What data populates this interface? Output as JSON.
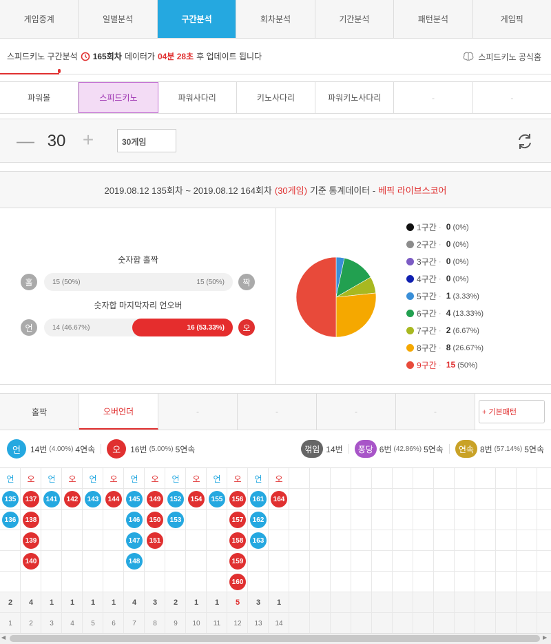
{
  "nav": {
    "tabs": [
      "게임중계",
      "일별분석",
      "구간분석",
      "회차분석",
      "기간분석",
      "패턴분석",
      "게임픽"
    ],
    "active": 2
  },
  "info": {
    "prefix": "스피드키노 구간분석",
    "round": "165회차",
    "middle": "데이터가",
    "time": "04분 28초",
    "suffix": "후 업데이트 됩니다",
    "official": "스피드키노 공식홈"
  },
  "games": {
    "tabs": [
      "파워볼",
      "스피드키노",
      "파워사다리",
      "키노사다리",
      "파워키노사다리",
      "-",
      "-"
    ],
    "active": 1
  },
  "counter": {
    "minus": "—",
    "value": "30",
    "plus": "+",
    "select": "30게임"
  },
  "stats": {
    "range": "2019.08.12 135회차 ~ 2019.08.12 164회차",
    "games": "(30게임)",
    "basis": "기준 통계데이터 -",
    "source": "베픽 라이브스코어"
  },
  "oddeven": {
    "title": "숫자합 홀짝",
    "left_icon": "홀",
    "right_icon": "짝",
    "left_text": "15 (50%)",
    "right_text": "15 (50%)",
    "left_value": 15,
    "right_value": 15
  },
  "overunder": {
    "title": "숫자합 마지막자리 언오버",
    "left_icon": "언",
    "right_icon": "오",
    "left_text": "14 (46.67%)",
    "right_text": "16 (53.33%)",
    "left_value": 14,
    "right_value": 16
  },
  "chart_data": {
    "type": "pie",
    "labels": [
      "1구간",
      "2구간",
      "3구간",
      "4구간",
      "5구간",
      "6구간",
      "7구간",
      "8구간",
      "9구간"
    ],
    "values": [
      0,
      0,
      0,
      0,
      1,
      4,
      2,
      8,
      15
    ],
    "pct": [
      "(0%)",
      "(0%)",
      "(0%)",
      "(0%)",
      "(3.33%)",
      "(13.33%)",
      "(6.67%)",
      "(26.67%)",
      "(50%)"
    ],
    "colors": [
      "#111111",
      "#8c8c8c",
      "#7c5cc4",
      "#1020b0",
      "#3a8fd8",
      "#22a050",
      "#a8b820",
      "#f5a800",
      "#e84a3a"
    ]
  },
  "pattern": {
    "tabs": [
      "홀짝",
      "오버언더",
      "-",
      "-",
      "-",
      "-"
    ],
    "active": 1,
    "basic_button": "+ 기본패턴"
  },
  "summary": {
    "under_icon": "언",
    "under_count": "14번",
    "under_pct": "(4.00%)",
    "under_streak": "4연속",
    "over_icon": "오",
    "over_count": "16번",
    "over_pct": "(5.00%)",
    "over_streak": "5연속",
    "break_label": "꺾임",
    "break_count": "14번",
    "pong_label": "퐁당",
    "pong_count": "6번",
    "pong_pct": "(42.86%)",
    "pong_streak": "5연속",
    "streak_label": "연속",
    "streak_count": "8번",
    "streak_pct": "(57.14%)",
    "streak_streak": "5연속"
  },
  "grid": {
    "columns": [
      {
        "head": "언",
        "type": "u",
        "balls": [
          "135",
          "136"
        ],
        "count": "2",
        "index": "1"
      },
      {
        "head": "오",
        "type": "o",
        "balls": [
          "137",
          "138",
          "139",
          "140"
        ],
        "count": "4",
        "index": "2"
      },
      {
        "head": "언",
        "type": "u",
        "balls": [
          "141"
        ],
        "count": "1",
        "index": "3"
      },
      {
        "head": "오",
        "type": "o",
        "balls": [
          "142"
        ],
        "count": "1",
        "index": "4"
      },
      {
        "head": "언",
        "type": "u",
        "balls": [
          "143"
        ],
        "count": "1",
        "index": "5"
      },
      {
        "head": "오",
        "type": "o",
        "balls": [
          "144"
        ],
        "count": "1",
        "index": "6"
      },
      {
        "head": "언",
        "type": "u",
        "balls": [
          "145",
          "146",
          "147",
          "148"
        ],
        "count": "4",
        "index": "7"
      },
      {
        "head": "오",
        "type": "o",
        "balls": [
          "149",
          "150",
          "151"
        ],
        "count": "3",
        "index": "8"
      },
      {
        "head": "언",
        "type": "u",
        "balls": [
          "152",
          "153"
        ],
        "count": "2",
        "index": "9"
      },
      {
        "head": "오",
        "type": "o",
        "balls": [
          "154"
        ],
        "count": "1",
        "index": "10"
      },
      {
        "head": "언",
        "type": "u",
        "balls": [
          "155"
        ],
        "count": "1",
        "index": "11"
      },
      {
        "head": "오",
        "type": "o",
        "balls": [
          "156",
          "157",
          "158",
          "159",
          "160"
        ],
        "count": "5",
        "index": "12",
        "highlight": true
      },
      {
        "head": "언",
        "type": "u",
        "balls": [
          "161",
          "162",
          "163"
        ],
        "count": "3",
        "index": "13"
      },
      {
        "head": "오",
        "type": "o",
        "balls": [
          "164"
        ],
        "count": "1",
        "index": "14"
      }
    ],
    "colors": {
      "under": "#25a8e0",
      "over": "#e03030"
    }
  }
}
